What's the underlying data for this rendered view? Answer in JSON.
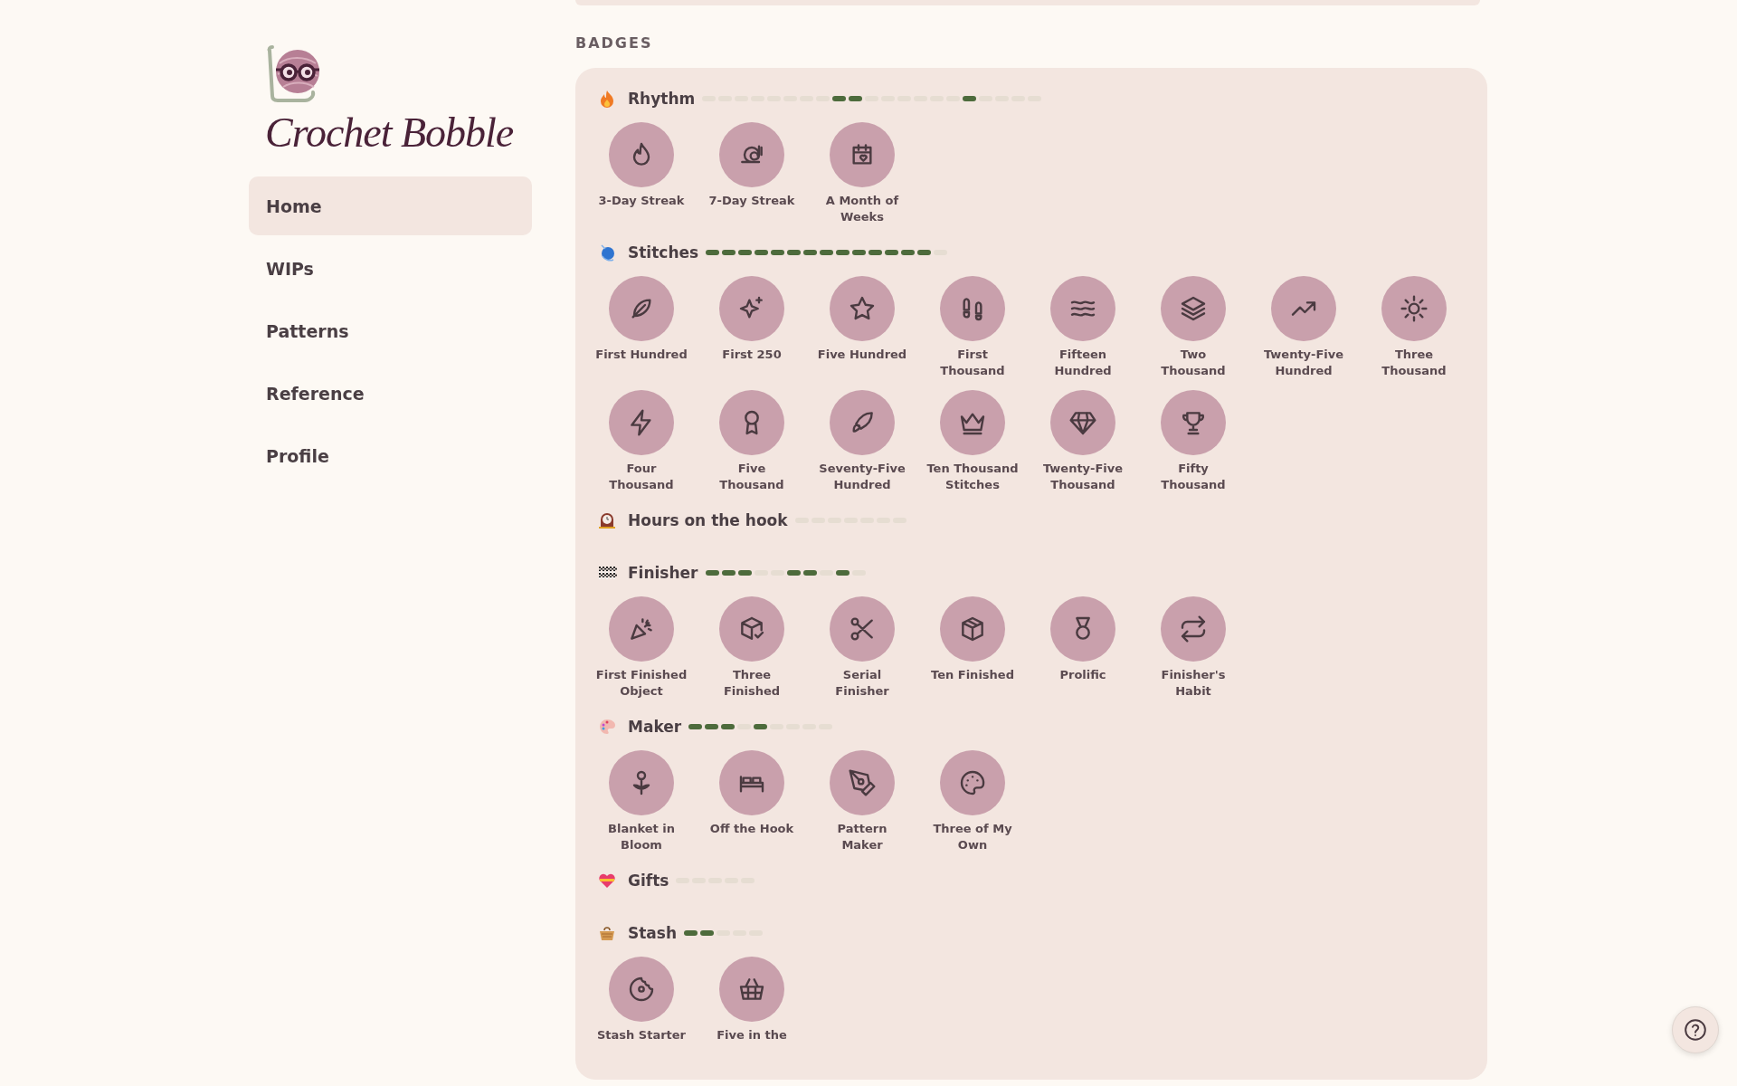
{
  "brand": {
    "name": "Crochet Bobble"
  },
  "nav": [
    {
      "label": "Home",
      "selected": true
    },
    {
      "label": "WIPs",
      "selected": false
    },
    {
      "label": "Patterns",
      "selected": false
    },
    {
      "label": "Reference",
      "selected": false
    },
    {
      "label": "Profile",
      "selected": false
    }
  ],
  "badges_heading": "BADGES",
  "groups": [
    {
      "title": "Rhythm",
      "segments": [
        {
          "filled": false
        },
        {
          "filled": false
        },
        {
          "filled": false
        },
        {
          "filled": false
        },
        {
          "filled": false
        },
        {
          "filled": false
        },
        {
          "filled": false
        },
        {
          "filled": false
        },
        {
          "filled": true
        },
        {
          "filled": true
        },
        {
          "filled": false
        },
        {
          "filled": false
        },
        {
          "filled": false
        },
        {
          "filled": false
        },
        {
          "filled": false
        },
        {
          "filled": false
        },
        {
          "filled": true
        },
        {
          "filled": false
        },
        {
          "filled": false
        },
        {
          "filled": false
        },
        {
          "filled": false
        }
      ],
      "badges": [
        "3-Day Streak",
        "7-Day Streak",
        "A Month of Weeks"
      ]
    },
    {
      "title": "Stitches",
      "segments": [
        {
          "filled": true
        },
        {
          "filled": true
        },
        {
          "filled": true
        },
        {
          "filled": true
        },
        {
          "filled": true
        },
        {
          "filled": true
        },
        {
          "filled": true
        },
        {
          "filled": true
        },
        {
          "filled": true
        },
        {
          "filled": true
        },
        {
          "filled": true
        },
        {
          "filled": true
        },
        {
          "filled": true
        },
        {
          "filled": true
        },
        {
          "filled": false
        }
      ],
      "badges": [
        "First Hundred",
        "First 250",
        "Five Hundred",
        "First Thousand",
        "Fifteen Hundred",
        "Two Thousand",
        "Twenty-Five Hundred",
        "Three Thousand",
        "Four Thousand",
        "Five Thousand",
        "Seventy-Five Hundred",
        "Ten Thousand Stitches",
        "Twenty-Five Thousand",
        "Fifty Thousand"
      ]
    },
    {
      "title": "Hours on the hook",
      "segments": [
        {
          "filled": false
        },
        {
          "filled": false
        },
        {
          "filled": false
        },
        {
          "filled": false
        },
        {
          "filled": false
        },
        {
          "filled": false
        },
        {
          "filled": false
        }
      ]
    },
    {
      "title": "Finisher",
      "segments": [
        {
          "filled": true
        },
        {
          "filled": true
        },
        {
          "filled": true
        },
        {
          "filled": false
        },
        {
          "filled": false
        },
        {
          "filled": true
        },
        {
          "filled": true
        },
        {
          "filled": false
        },
        {
          "filled": true
        },
        {
          "filled": false
        }
      ],
      "badges": [
        "First Finished Object",
        "Three Finished",
        "Serial Finisher",
        "Ten Finished",
        "Prolific",
        "Finisher's Habit"
      ]
    },
    {
      "title": "Maker",
      "segments": [
        {
          "filled": true
        },
        {
          "filled": true
        },
        {
          "filled": true
        },
        {
          "filled": false
        },
        {
          "filled": true
        },
        {
          "filled": false
        },
        {
          "filled": false
        },
        {
          "filled": false
        },
        {
          "filled": false
        }
      ],
      "badges": [
        "Blanket in Bloom",
        "Off the Hook",
        "Pattern Maker",
        "Three of My Own"
      ]
    },
    {
      "title": "Gifts",
      "segments": [
        {
          "filled": false
        },
        {
          "filled": false
        },
        {
          "filled": false
        },
        {
          "filled": false
        },
        {
          "filled": false
        }
      ]
    },
    {
      "title": "Stash",
      "segments": [
        {
          "filled": true
        },
        {
          "filled": true
        },
        {
          "filled": false
        },
        {
          "filled": false
        },
        {
          "filled": false
        }
      ],
      "badges": [
        "Stash Starter",
        "Five in the"
      ]
    }
  ]
}
